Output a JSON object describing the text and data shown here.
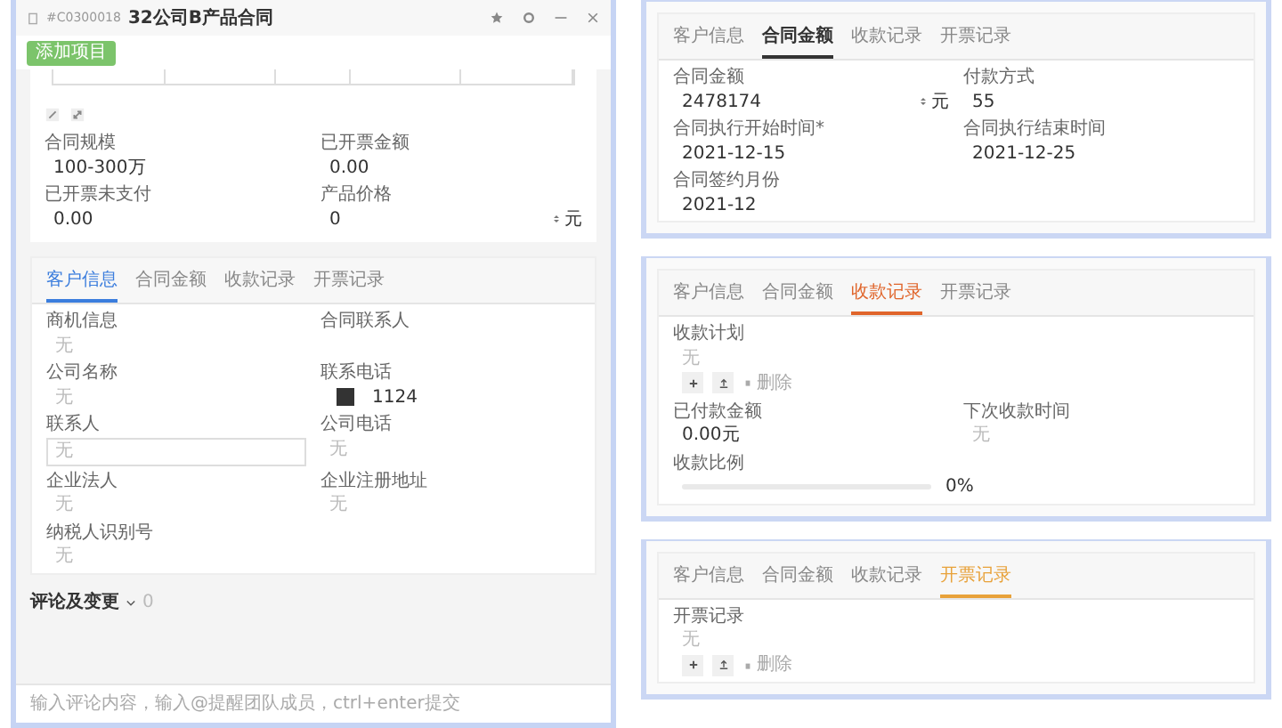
{
  "window": {
    "code": "#C0300018",
    "title": "32公司B产品合同",
    "toolbar_button": "添加项目"
  },
  "summary_fields": [
    {
      "kind": "text",
      "label": "合同规模",
      "value": "100-300万"
    },
    {
      "kind": "text",
      "label": "已开票金额",
      "value": "0.00"
    },
    {
      "kind": "text",
      "label": "已开票未支付",
      "value": "0.00"
    },
    {
      "kind": "text",
      "label": "产品价格",
      "value": "0",
      "unit": "元"
    }
  ],
  "panels": [
    {
      "tabs": [
        {
          "label": "客户信息",
          "selected": true,
          "color": "#3b7ddd"
        },
        {
          "label": "合同金额",
          "selected": false
        },
        {
          "label": "收款记录",
          "selected": false
        },
        {
          "label": "开票记录",
          "selected": false
        }
      ],
      "fields": [
        {
          "kind": "text",
          "label": "商机信息",
          "value": "无",
          "muted": true
        },
        {
          "kind": "text",
          "label": "合同联系人"
        },
        {
          "kind": "text",
          "label": "公司名称",
          "value": "无",
          "muted": true
        },
        {
          "kind": "phone",
          "label": "联系电话",
          "value": "1124"
        },
        {
          "kind": "input",
          "label": "联系人",
          "placeholder": "无"
        },
        {
          "kind": "text",
          "label": "公司电话",
          "value": "无",
          "muted": true
        },
        {
          "kind": "text",
          "label": "企业法人",
          "value": "无",
          "muted": true
        },
        {
          "kind": "text",
          "label": "企业注册地址",
          "value": "无",
          "muted": true
        },
        {
          "kind": "text",
          "label": "纳税人识别号",
          "value": "无",
          "muted": true
        }
      ]
    },
    {
      "tabs": [
        {
          "label": "客户信息",
          "selected": false
        },
        {
          "label": "合同金额",
          "selected": true,
          "color": "#333333"
        },
        {
          "label": "收款记录",
          "selected": false
        },
        {
          "label": "开票记录",
          "selected": false
        }
      ],
      "fields": [
        {
          "kind": "text",
          "label": "合同金额",
          "value": "2478174",
          "unit": "元",
          "muted": false
        },
        {
          "kind": "text",
          "label": "付款方式",
          "value": "55",
          "muted": false
        },
        {
          "kind": "text",
          "label": "合同执行开始时间*",
          "value": "2021-12-15",
          "muted": false
        },
        {
          "kind": "text",
          "label": "合同执行结束时间",
          "value": "2021-12-25",
          "muted": false
        },
        {
          "kind": "text",
          "label": "合同签约月份",
          "value": "2021-12",
          "muted": false
        }
      ]
    },
    {
      "tabs": [
        {
          "label": "客户信息",
          "selected": false
        },
        {
          "label": "合同金额",
          "selected": false
        },
        {
          "label": "收款记录",
          "selected": true,
          "color": "#e0652b"
        },
        {
          "label": "开票记录",
          "selected": false
        }
      ],
      "fields": [
        {
          "kind": "list",
          "label": "收款计划",
          "value": "无",
          "action": "删除"
        },
        {
          "kind": "text",
          "label": "已付款金额",
          "value": "0.00元",
          "muted": false
        },
        {
          "kind": "text",
          "label": "下次收款时间",
          "value": "无",
          "muted": true
        },
        {
          "kind": "progress",
          "label": "收款比例",
          "level": 0,
          "reading": "0%"
        }
      ]
    },
    {
      "tabs": [
        {
          "label": "客户信息",
          "selected": false
        },
        {
          "label": "合同金额",
          "selected": false
        },
        {
          "label": "收款记录",
          "selected": false
        },
        {
          "label": "开票记录",
          "selected": true,
          "color": "#e8a23a"
        }
      ],
      "fields": [
        {
          "kind": "list",
          "label": "开票记录",
          "value": "无",
          "action": "删除"
        }
      ]
    }
  ],
  "comments": {
    "title": "评论及变更",
    "count": "0",
    "placeholder": "输入评论内容，输入@提醒团队成员，ctrl+enter提交"
  }
}
